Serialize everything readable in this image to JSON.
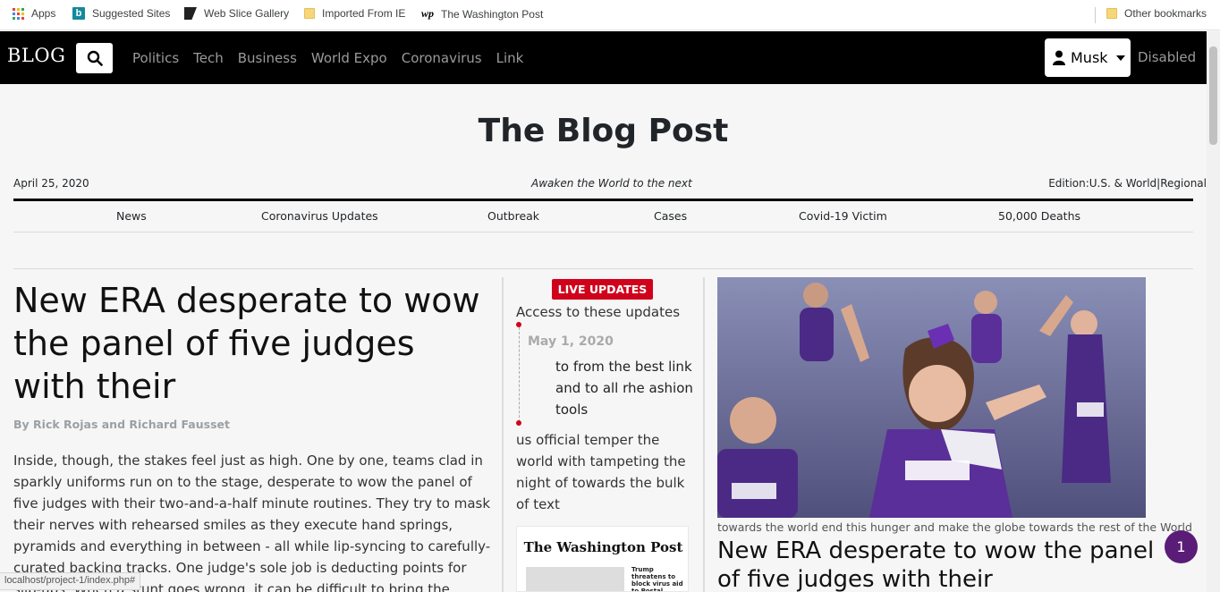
{
  "bookmarks": {
    "items": [
      "Apps",
      "Suggested Sites",
      "Web Slice Gallery",
      "Imported From IE",
      "The Washington Post"
    ],
    "other": "Other bookmarks"
  },
  "navbar": {
    "brand": "BLOG",
    "links": [
      "Politics",
      "Tech",
      "Business",
      "World Expo",
      "Coronavirus",
      "Link"
    ],
    "user": "Musk",
    "disabled": "Disabled"
  },
  "masthead": {
    "title": "The Blog Post",
    "date": "April 25, 2020",
    "tagline": "Awaken the World to the next",
    "edition_label": "Edition:",
    "edition_value": "U.S. & World",
    "edition_sep": "|",
    "edition_regional": "Regional"
  },
  "sections": [
    "News",
    "Coronavirus Updates",
    "Outbreak",
    "Cases",
    "Covid-19 Victim",
    "50,000 Deaths"
  ],
  "article": {
    "headline": "New ERA desperate to wow the panel of five judges with their",
    "byline": "By Rick Rojas and Richard Fausset",
    "body": "Inside, though, the stakes feel just as high. One by one, teams clad in sparkly uniforms run on to the stage, desperate to wow the panel of five judges with their two-and-a-half minute routines. They try to mask their nerves with rehearsed smiles as they execute hand springs, pyramids and everything in between - all while lip-syncing to carefully-curated backing tracks. One judge's sole job is deducting points for slip-ups. When a stunt goes wrong, it can be difficult to bring the performance back."
  },
  "live": {
    "badge": "LIVE UPDATES",
    "intro": "Access to these updates",
    "date": "May 1, 2020",
    "update1": "to from the best link and to all rhe ashion tools",
    "update2": "us official temper the world with tampeting the night of towards the bulk of text",
    "paper_logo": "The Washington Post",
    "paper_sub": "Trump threatens to block virus aid to Postal Service"
  },
  "feature": {
    "caption": "towards the world end this hunger and make the globe towards the rest of the World",
    "headline": "New ERA desperate to wow the panel of five judges with their"
  },
  "notification_count": "1",
  "status_url": "localhost/project-1/index.php#",
  "colors": {
    "accent_red": "#d0021b",
    "badge_purple": "#5b1c77"
  }
}
